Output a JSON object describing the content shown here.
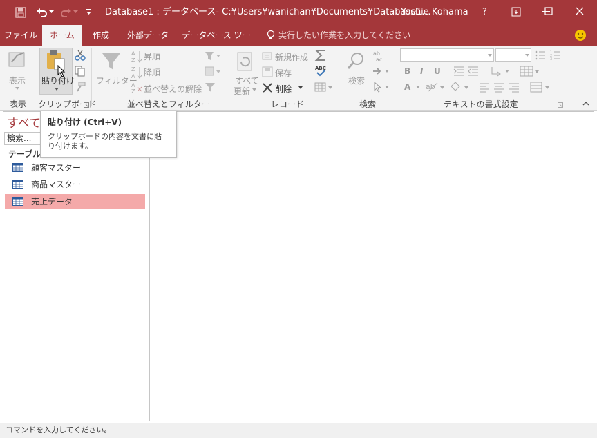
{
  "title": {
    "text": "Database1 : データベース- C:¥Users¥wanichan¥Documents¥Database1…",
    "user": "Yoshie Kohama",
    "help": "?"
  },
  "tabs": [
    "ファイル",
    "ホーム",
    "作成",
    "外部データ",
    "データベース ツール"
  ],
  "tellme": "実行したい作業を入力してください",
  "ribbon": {
    "view": {
      "label": "表示",
      "group": "表示"
    },
    "clipboard": {
      "paste": "貼り付け",
      "group": "クリップボード"
    },
    "sort": {
      "filter": "フィルター",
      "asc": "昇順",
      "desc": "降順",
      "clear": "並べ替えの解除",
      "group": "並べ替えとフィルター"
    },
    "records": {
      "refresh1": "すべて",
      "refresh2": "更新",
      "new": "新規作成",
      "save": "保存",
      "delete": "削除",
      "group": "レコード"
    },
    "find": {
      "label": "検索",
      "group": "検索"
    },
    "textfmt": {
      "group": "テキストの書式設定",
      "bold": "B",
      "italic": "I",
      "underline": "U"
    }
  },
  "nav": {
    "title": "すべて",
    "search_placeholder": "検索...",
    "section": "テーブル",
    "items": [
      "顧客マスター",
      "商品マスター",
      "売上データ"
    ]
  },
  "tooltip": {
    "title": "貼り付け (Ctrl+V)",
    "body": "クリップボードの内容を文書に貼り付けます。"
  },
  "status": "コマンドを入力してください。",
  "colors": {
    "accent": "#a4373a",
    "selection": "#f4a9a9",
    "ribbon": "#f3f3f3"
  }
}
